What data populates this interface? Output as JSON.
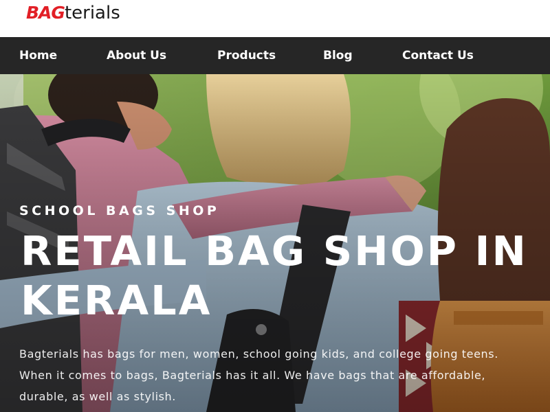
{
  "logo": {
    "brand_part": "BAG",
    "rest_part": "terials",
    "brand_color": "#e21f26"
  },
  "nav": {
    "items": [
      {
        "label": "Home"
      },
      {
        "label": "About Us"
      },
      {
        "label": "Products"
      },
      {
        "label": "Blog"
      },
      {
        "label": "Contact Us"
      }
    ],
    "background": "#262626"
  },
  "hero": {
    "eyebrow": "SCHOOL BAGS SHOP",
    "title": "RETAIL BAG SHOP IN KERALA",
    "description": "Bagterials has bags for men, women, school going kids, and college going teens. When it comes to bags, Bagterials has it all. We have bags that are affordable, durable, as well as stylish."
  }
}
